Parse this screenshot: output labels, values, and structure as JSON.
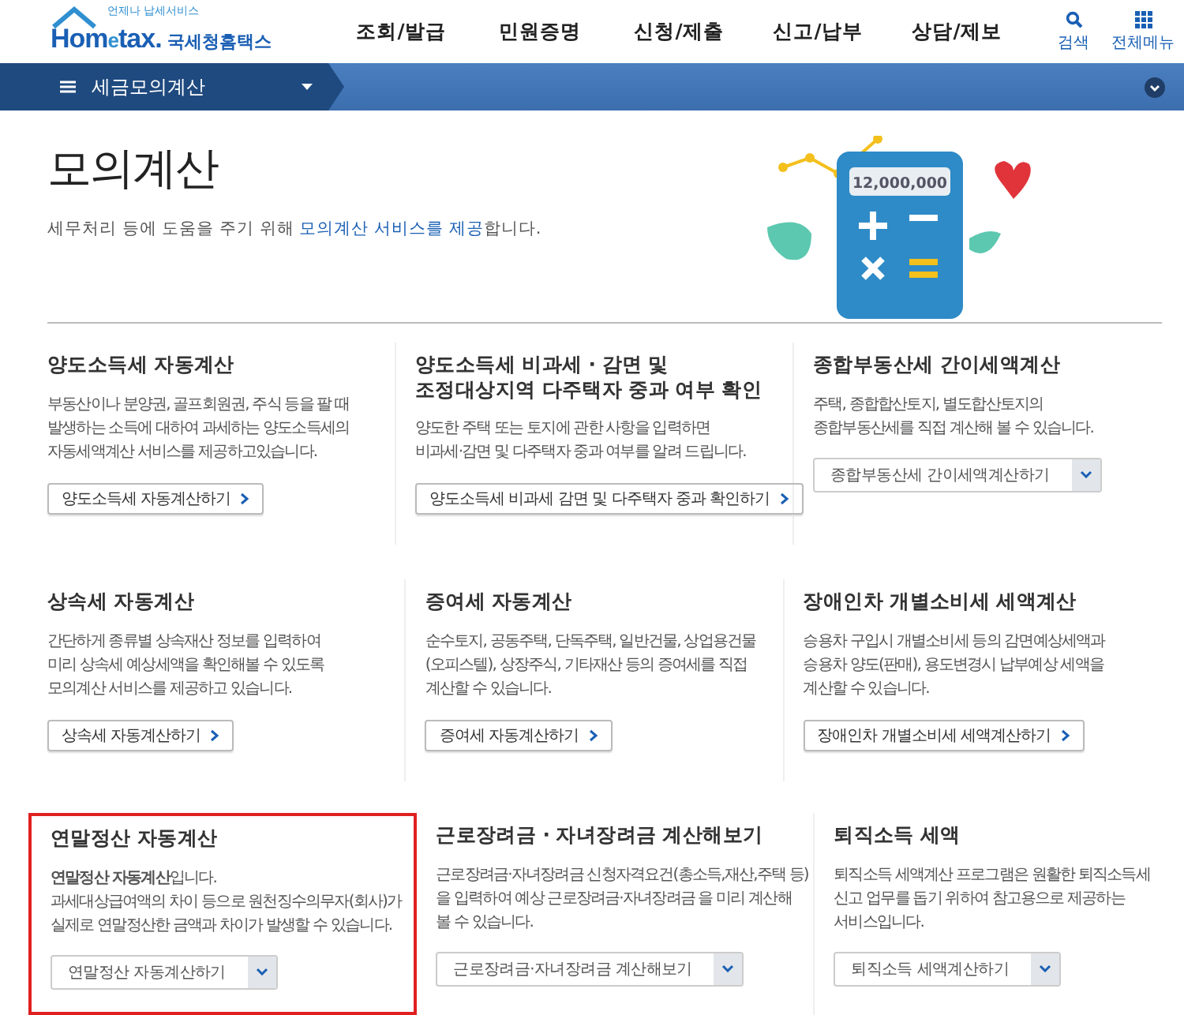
{
  "header": {
    "logo": {
      "tagline": "언제나 납세서비스",
      "brand_main": "Hom",
      "brand_e": "e",
      "brand_rest": "tax.",
      "brand_kr": "국세청홈택스"
    },
    "menu": [
      {
        "label": "조회/발급"
      },
      {
        "label": "민원증명"
      },
      {
        "label": "신청/제출"
      },
      {
        "label": "신고/납부"
      },
      {
        "label": "상담/제보"
      }
    ],
    "utilities": [
      {
        "kind": "search",
        "label": "검색"
      },
      {
        "kind": "grid",
        "label": "전체메뉴"
      }
    ]
  },
  "location_bar": {
    "current": "세금모의계산"
  },
  "hero": {
    "title": "모의계산",
    "link_text": "모의계산 서비스를 제공",
    "before": "세무처리 등에 도움을 주기 위해 ",
    "after": "합니다.",
    "calculator_display": "12,000,000"
  },
  "cards": [
    {
      "title": "양도소득세 자동계산",
      "lines": [
        "부동산이나 분양권, 골프회원권, 주식 등을 팔 때",
        "발생하는 소득에 대하여 과세하는 양도소득세의",
        "자동세액계산 서비스를 제공하고있습니다."
      ],
      "button": {
        "kind": "link",
        "label": "양도소득세 자동계산하기"
      },
      "highlighted": false
    },
    {
      "title": "양도소득세 비과세 · 감면 및\n조정대상지역 다주택자 중과 여부 확인",
      "lines": [
        "양도한 주택 또는 토지에 관한 사항을 입력하면",
        "비과세·감면 및 다주택자 중과 여부를 알려 드립니다."
      ],
      "button": {
        "kind": "link",
        "label": "양도소득세 비과세 감면 및 다주택자 중과 확인하기"
      },
      "highlighted": false
    },
    {
      "title": "종합부동산세 간이세액계산",
      "lines": [
        "주택, 종합합산토지, 별도합산토지의",
        "종합부동산세를 직접 계산해 볼 수 있습니다."
      ],
      "button": {
        "kind": "select",
        "label": "종합부동산세 간이세액계산하기"
      },
      "highlighted": false
    },
    {
      "title": "상속세 자동계산",
      "lines": [
        "간단하게 종류별 상속재산 정보를 입력하여",
        "미리 상속세 예상세액을 확인해볼 수 있도록",
        "모의계산 서비스를 제공하고 있습니다."
      ],
      "button": {
        "kind": "link",
        "label": "상속세 자동계산하기"
      },
      "highlighted": false
    },
    {
      "title": "증여세 자동계산",
      "lines": [
        "순수토지, 공동주택, 단독주택, 일반건물, 상업용건물",
        "(오피스텔), 상장주식, 기타재산 등의 증여세를 직접",
        "계산할 수 있습니다."
      ],
      "button": {
        "kind": "link",
        "label": "증여세 자동계산하기"
      },
      "highlighted": false
    },
    {
      "title": "장애인차 개별소비세 세액계산",
      "lines": [
        "승용차 구입시 개별소비세 등의 감면예상세액과",
        "승용차 양도(판매), 용도변경시 납부예상 세액을",
        "계산할 수 있습니다."
      ],
      "button": {
        "kind": "link",
        "label": "장애인차 개별소비세 세액계산하기"
      },
      "highlighted": false
    },
    {
      "title": "연말정산 자동계산",
      "lines": [
        "**연말정산 자동계산**입니다.",
        "과세대상급여액의 차이 등으로 원천징수의무자(회사)가",
        "실제로 연말정산한 금액과 차이가 발생할 수 있습니다."
      ],
      "button": {
        "kind": "select",
        "label": "연말정산 자동계산하기"
      },
      "highlighted": true
    },
    {
      "title": "근로장려금 · 자녀장려금 계산해보기",
      "lines": [
        "근로장려금·자녀장려금 신청자격요건(총소득,재산,주택 등)",
        "을 입력하여 예상 근로장려금·자녀장려금 을 미리 계산해",
        "볼 수 있습니다."
      ],
      "button": {
        "kind": "select",
        "label": "근로장려금·자녀장려금 계산해보기"
      },
      "highlighted": false
    },
    {
      "title": "퇴직소득 세액",
      "lines": [
        "퇴직소득 세액계산 프로그램은 원활한 퇴직소득세",
        "신고 업무를 돕기 위하여 참고용으로 제공하는",
        "서비스입니다."
      ],
      "button": {
        "kind": "select",
        "label": "퇴직소득 세액계산하기"
      },
      "highlighted": false
    }
  ]
}
